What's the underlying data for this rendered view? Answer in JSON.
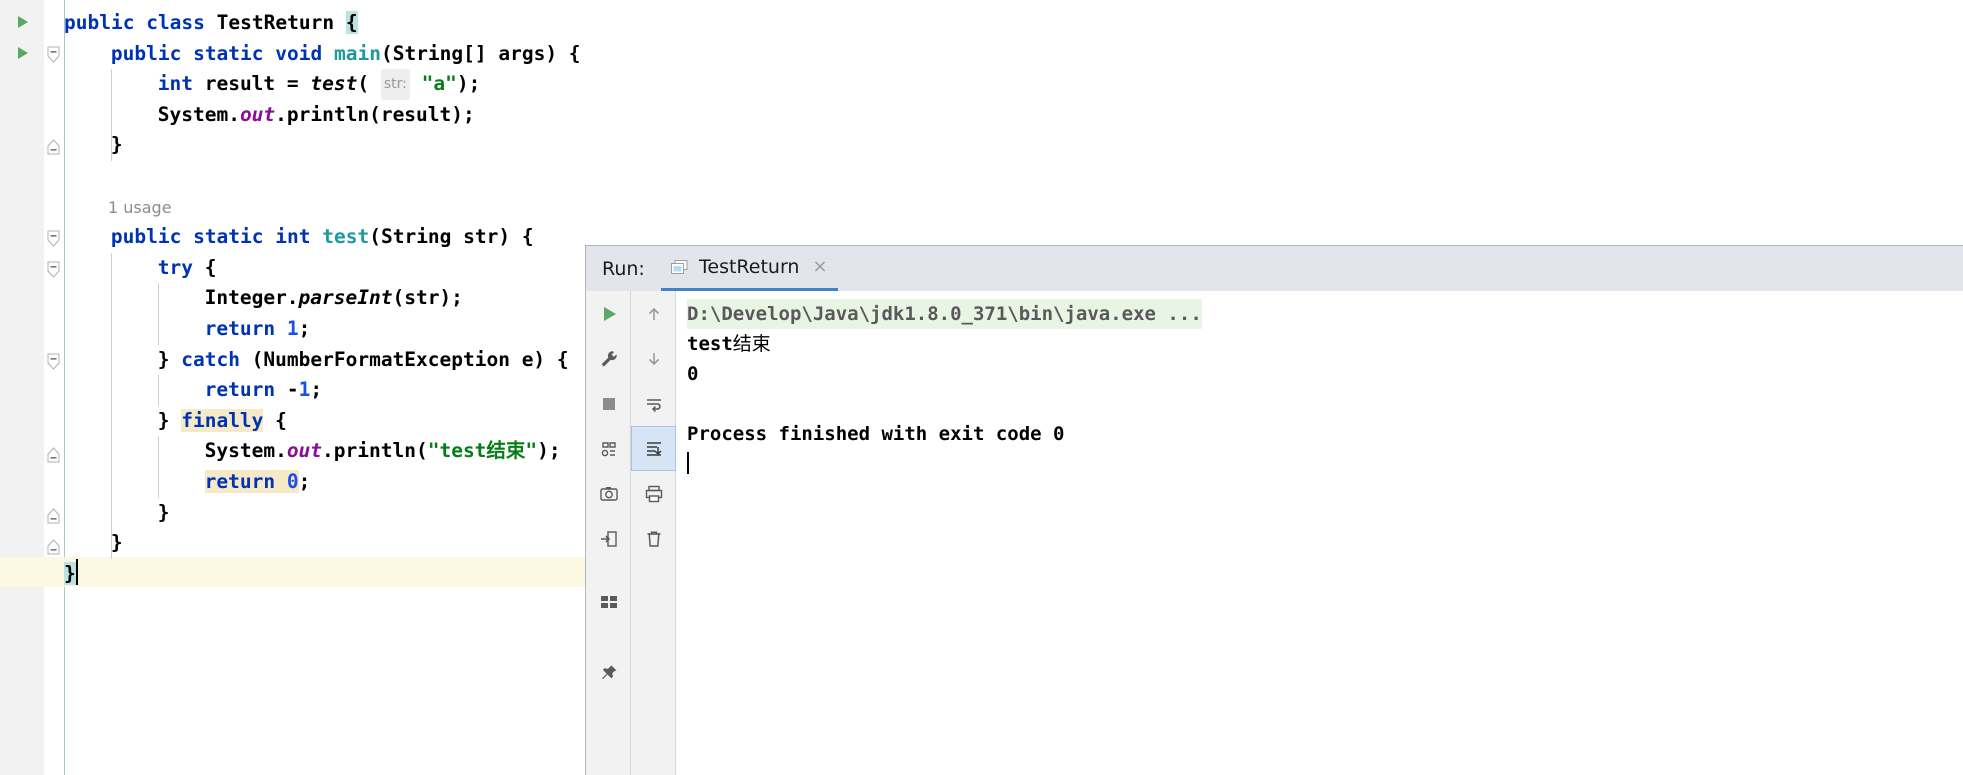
{
  "editor": {
    "language": "java",
    "lines": [
      {
        "indent": 0,
        "tokens": [
          {
            "t": "public",
            "c": "kw"
          },
          {
            "t": " ",
            "c": "plain"
          },
          {
            "t": "class",
            "c": "kw"
          },
          {
            "t": " ",
            "c": "plain"
          },
          {
            "t": "TestReturn",
            "c": "plain"
          },
          {
            "t": " ",
            "c": "plain"
          },
          {
            "t": "{",
            "c": "hl-brace"
          }
        ]
      },
      {
        "indent": 1,
        "tokens": [
          {
            "t": "public",
            "c": "kw"
          },
          {
            "t": " ",
            "c": "plain"
          },
          {
            "t": "static",
            "c": "kw"
          },
          {
            "t": " ",
            "c": "plain"
          },
          {
            "t": "void",
            "c": "kw"
          },
          {
            "t": " ",
            "c": "plain"
          },
          {
            "t": "main",
            "c": "cls"
          },
          {
            "t": "(String[] args) {",
            "c": "plain"
          }
        ]
      },
      {
        "indent": 2,
        "tokens": [
          {
            "t": "int",
            "c": "kw"
          },
          {
            "t": " result = ",
            "c": "plain"
          },
          {
            "t": "test",
            "c": "method"
          },
          {
            "t": "( ",
            "c": "plain"
          },
          {
            "t": "str:",
            "c": "param-hint"
          },
          {
            "t": " ",
            "c": "plain"
          },
          {
            "t": "\"a\"",
            "c": "str"
          },
          {
            "t": ");",
            "c": "plain"
          }
        ]
      },
      {
        "indent": 2,
        "tokens": [
          {
            "t": "System.",
            "c": "plain"
          },
          {
            "t": "out",
            "c": "field"
          },
          {
            "t": ".println(result);",
            "c": "plain"
          }
        ]
      },
      {
        "indent": 1,
        "tokens": [
          {
            "t": "}",
            "c": "plain"
          }
        ]
      },
      {
        "indent": 0,
        "tokens": []
      },
      {
        "indent": 0,
        "tokens": []
      },
      {
        "indent": 1,
        "tokens": [
          {
            "t": "public",
            "c": "kw"
          },
          {
            "t": " ",
            "c": "plain"
          },
          {
            "t": "static",
            "c": "kw"
          },
          {
            "t": " ",
            "c": "plain"
          },
          {
            "t": "int",
            "c": "kw"
          },
          {
            "t": " ",
            "c": "plain"
          },
          {
            "t": "test",
            "c": "cls"
          },
          {
            "t": "(String str) {",
            "c": "plain"
          }
        ]
      },
      {
        "indent": 2,
        "tokens": [
          {
            "t": "try",
            "c": "kw"
          },
          {
            "t": " {",
            "c": "plain"
          }
        ]
      },
      {
        "indent": 3,
        "tokens": [
          {
            "t": "Integer.",
            "c": "plain"
          },
          {
            "t": "parseInt",
            "c": "method"
          },
          {
            "t": "(str);",
            "c": "plain"
          }
        ]
      },
      {
        "indent": 3,
        "tokens": [
          {
            "t": "return",
            "c": "kw"
          },
          {
            "t": " ",
            "c": "plain"
          },
          {
            "t": "1",
            "c": "num"
          },
          {
            "t": ";",
            "c": "plain"
          }
        ]
      },
      {
        "indent": 2,
        "tokens": [
          {
            "t": "} ",
            "c": "plain"
          },
          {
            "t": "catch",
            "c": "kw"
          },
          {
            "t": " (NumberFormatException e) {",
            "c": "plain"
          }
        ]
      },
      {
        "indent": 3,
        "tokens": [
          {
            "t": "return",
            "c": "kw"
          },
          {
            "t": " ",
            "c": "plain"
          },
          {
            "t": "-",
            "c": "plain"
          },
          {
            "t": "1",
            "c": "num"
          },
          {
            "t": ";",
            "c": "plain"
          }
        ]
      },
      {
        "indent": 2,
        "tokens": [
          {
            "t": "} ",
            "c": "plain"
          },
          {
            "t": "finally",
            "c": "kw hl-kw"
          },
          {
            "t": " {",
            "c": "plain"
          }
        ]
      },
      {
        "indent": 3,
        "tokens": [
          {
            "t": "System.",
            "c": "plain"
          },
          {
            "t": "out",
            "c": "field"
          },
          {
            "t": ".println(",
            "c": "plain"
          },
          {
            "t": "\"test结束\"",
            "c": "str"
          },
          {
            "t": ");",
            "c": "plain"
          }
        ]
      },
      {
        "indent": 3,
        "tokens": [
          {
            "t": "return",
            "c": "kw hl-kw"
          },
          {
            "t": " ",
            "c": "hl-kw"
          },
          {
            "t": "0",
            "c": "num hl-kw"
          },
          {
            "t": ";",
            "c": "plain"
          }
        ]
      },
      {
        "indent": 2,
        "tokens": [
          {
            "t": "}",
            "c": "plain"
          }
        ]
      },
      {
        "indent": 1,
        "tokens": [
          {
            "t": "}",
            "c": "plain"
          }
        ]
      },
      {
        "indent": 0,
        "tokens": [
          {
            "t": "}",
            "c": "hl-brace"
          }
        ]
      }
    ],
    "usage_hint": "1 usage",
    "gutter_run_markers": [
      "run-class-marker",
      "run-method-marker"
    ],
    "colors": {
      "keyword": "#0033b3",
      "string": "#067d17",
      "number": "#1750eb",
      "field": "#871094",
      "class": "#20999d",
      "brace_match_highlight": "#b9e4e2",
      "keyword_highlight": "#f5e9c8",
      "caret_line": "#fdf8e3"
    }
  },
  "run_panel": {
    "label": "Run:",
    "tab": {
      "title": "TestReturn",
      "close": "×",
      "icon": "run-configuration-icon"
    },
    "toolbar_left": [
      {
        "name": "rerun-button",
        "icon": "play-icon"
      },
      {
        "name": "edit-configuration-button",
        "icon": "wrench-icon"
      },
      {
        "name": "stop-button",
        "icon": "stop-square-icon"
      },
      {
        "name": "restore-layout-button",
        "icon": "layout-icon"
      },
      {
        "name": "screenshot-button",
        "icon": "camera-icon"
      },
      {
        "name": "export-button",
        "icon": "export-icon"
      },
      {
        "name": "console-toggle-button",
        "icon": "console-icon"
      },
      {
        "name": "pin-tab-button",
        "icon": "pin-icon"
      }
    ],
    "toolbar_right": [
      {
        "name": "up-the-stack-trace-button",
        "icon": "arrow-up-icon"
      },
      {
        "name": "down-the-stack-trace-button",
        "icon": "arrow-down-icon"
      },
      {
        "name": "soft-wrap-button",
        "icon": "soft-wrap-icon"
      },
      {
        "name": "scroll-to-end-button",
        "icon": "scroll-end-icon"
      },
      {
        "name": "print-button",
        "icon": "printer-icon"
      },
      {
        "name": "clear-all-button",
        "icon": "trash-icon"
      }
    ],
    "console": {
      "command_line": "D:\\Develop\\Java\\jdk1.8.0_371\\bin\\java.exe ...",
      "lines": [
        "test结束",
        "0",
        "",
        "Process finished with exit code 0"
      ],
      "command_bg": "#e8f5e4",
      "has_caret": true
    }
  }
}
